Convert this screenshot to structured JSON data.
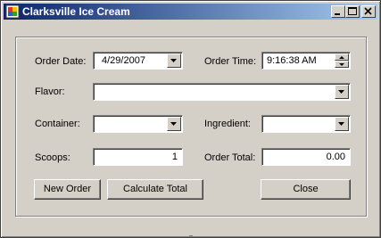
{
  "window": {
    "title": "Clarksville Ice Cream"
  },
  "form": {
    "order_date_label": "Order Date:",
    "order_date_value": "4/29/2007",
    "order_time_label": "Order Time:",
    "order_time_value": "9:16:38 AM",
    "flavor_label": "Flavor:",
    "flavor_value": "",
    "container_label": "Container:",
    "container_value": "",
    "ingredient_label": "Ingredient:",
    "ingredient_value": "",
    "scoops_label": "Scoops:",
    "scoops_value": "1",
    "order_total_label": "Order Total:",
    "order_total_value": "0.00"
  },
  "buttons": {
    "new_order": "New Order",
    "calculate_total": "Calculate Total",
    "close": "Close"
  },
  "icons": {
    "app": "app-icon",
    "minimize": "minimize-icon",
    "maximize": "maximize-icon",
    "close": "close-icon",
    "dropdown": "chevron-down-icon"
  }
}
